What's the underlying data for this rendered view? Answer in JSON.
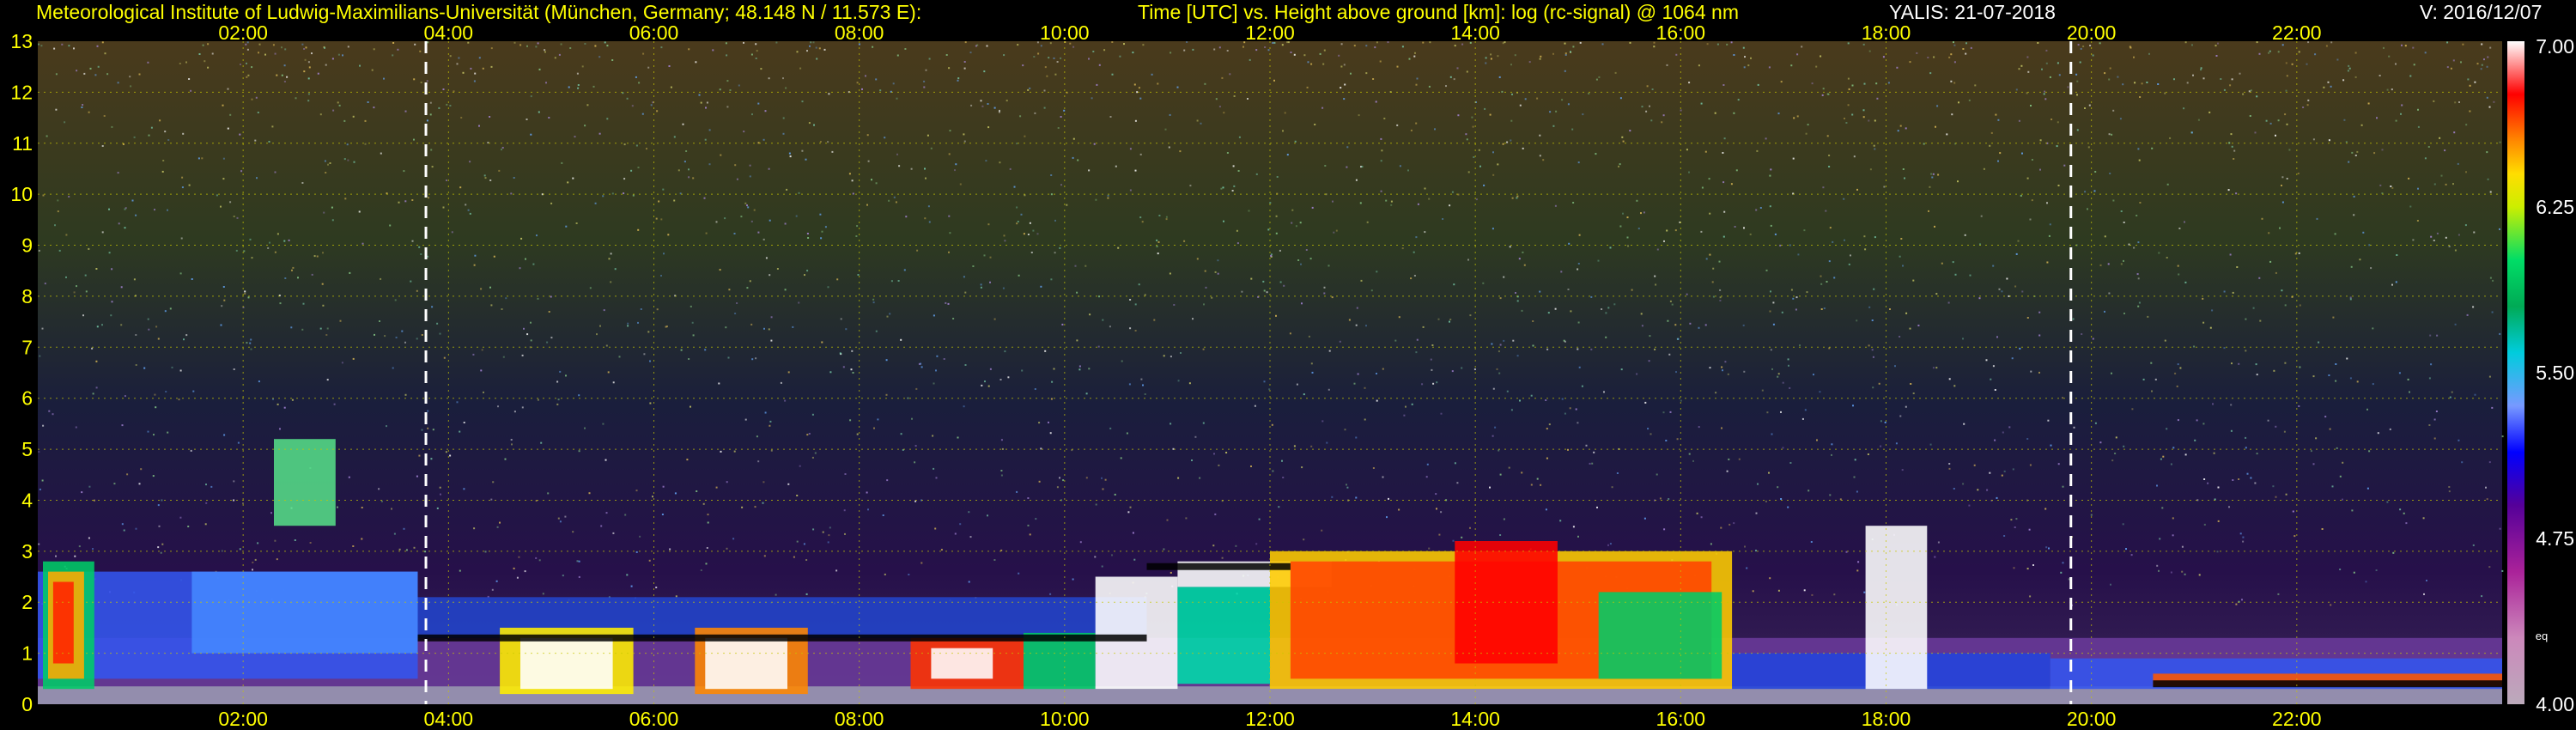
{
  "header": {
    "institute": "Meteorological Institute of Ludwig-Maximilians-Universität (München, Germany; 48.148 N / 11.573 E):",
    "plot_desc": "Time [UTC] vs. Height above ground [km]: log (rc-signal) @ 1064 nm",
    "station_date": "YALIS: 21-07-2018",
    "version": "V: 2016/12/07"
  },
  "colors": {
    "background": "#000000",
    "text": "#ffff00",
    "grid": "#c8c800",
    "markers": "#ffffff"
  },
  "chart_data": {
    "type": "heatmap",
    "title": "Time [UTC] vs. Height above ground [km]: log (rc-signal) @ 1064 nm",
    "xlabel": "",
    "ylabel": "",
    "x_ticks": [
      "02:00",
      "04:00",
      "06:00",
      "08:00",
      "10:00",
      "12:00",
      "14:00",
      "16:00",
      "18:00",
      "20:00",
      "22:00"
    ],
    "x_tick_hours": [
      2,
      4,
      6,
      8,
      10,
      12,
      14,
      16,
      18,
      20,
      22
    ],
    "xlim_hours": [
      0,
      24
    ],
    "y_ticks": [
      0,
      1,
      2,
      3,
      4,
      5,
      6,
      7,
      8,
      9,
      10,
      11,
      12,
      13
    ],
    "ylim": [
      0,
      13
    ],
    "grid": true,
    "marker_lines_hours": [
      3.78,
      19.8
    ],
    "colorbar": {
      "ticks": [
        "7.00",
        "6.25",
        "5.50",
        "4.75",
        "4.00"
      ],
      "range": [
        4.0,
        7.0
      ],
      "label": "eq"
    }
  }
}
